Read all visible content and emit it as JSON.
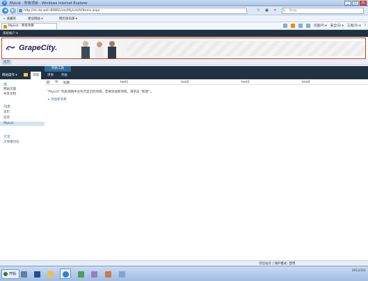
{
  "browser": {
    "window_title": "MyList - 所有项目 - Windows Internet Explorer",
    "url": "http://dc-de-wsh:8080/Lists/MyList/AllItems.aspx",
    "search_placeholder": "Bing",
    "favorites_label": "收藏夹",
    "fav_links": [
      "建议网站 ▾",
      "网页快讯库 ▾"
    ],
    "tab_title": "MyList - 所有项目",
    "cmd_items": [
      "页面(P) ▾",
      "安全(S) ▾",
      "工具(O) ▾",
      "?"
    ]
  },
  "sharepoint": {
    "account_menu": "系统帐户 ▾",
    "logo_text": "GrapeCity.",
    "home_tab": "主页",
    "site_actions": "网站操作 ▾",
    "browse_tab": "浏览",
    "list_tools_group": "列表工具",
    "ribbon_tabs": [
      "项目",
      "列表"
    ]
  },
  "left_nav": {
    "library_heading": "库",
    "library_links": [
      "网站页面",
      "共享文档"
    ],
    "lists_heading": "列表",
    "lists_links": [
      "日历",
      "任务"
    ],
    "selected_list": "MyList",
    "discussions_heading": "讨论",
    "discussions_links": [
      "工作组讨论"
    ]
  },
  "list_view": {
    "columns": [
      "标题",
      "test1",
      "test2",
      "test3",
      "test4"
    ],
    "empty_message": "\"MyList\" 列表视图中没有可显示的项目。若要添加新项目，请单击 \"新建\" 。",
    "add_item_label": "添加新项目"
  },
  "status_bar": {
    "zone": "可信站点 | 保护模式: 禁用"
  },
  "taskbar": {
    "start_label": "开始",
    "clock": "2012/3/1"
  }
}
